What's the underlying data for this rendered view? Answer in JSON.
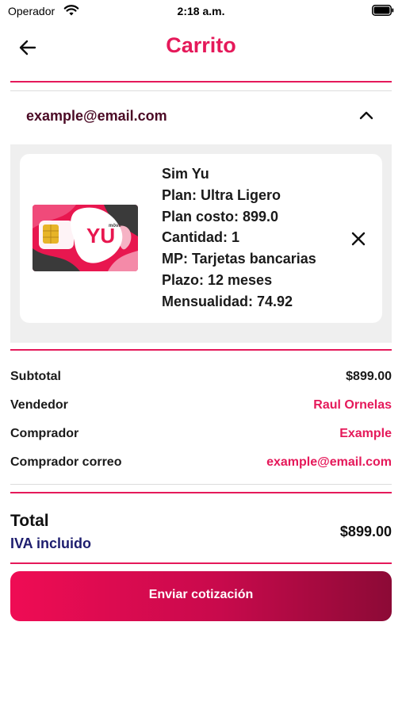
{
  "status_bar": {
    "carrier": "Operador",
    "time": "2:18 a.m."
  },
  "nav": {
    "title": "Carrito"
  },
  "cart": {
    "email": "example@email.com",
    "product": {
      "name": "Sim Yu",
      "plan": "Plan: Ultra Ligero",
      "plan_cost": "Plan costo: 899.0",
      "quantity": "Cantidad: 1",
      "payment_method": "MP: Tarjetas bancarias",
      "term": "Plazo: 12 meses",
      "monthly": "Mensualidad: 74.92",
      "image_brand": "YU",
      "image_subbrand": "mövil"
    }
  },
  "summary": {
    "subtotal_label": "Subtotal",
    "subtotal_value": "$899.00",
    "seller_label": "Vendedor",
    "seller_value": "Raul Ornelas",
    "buyer_label": "Comprador",
    "buyer_value": "Example",
    "buyer_email_label": "Comprador correo",
    "buyer_email_value": "example@email.com"
  },
  "total": {
    "label": "Total",
    "tax_note": "IVA incluido",
    "value": "$899.00"
  },
  "actions": {
    "send_label": "Enviar cotización"
  },
  "colors": {
    "accent": "#e5195a",
    "dark_maroon": "#4b0a25",
    "navy": "#1d1d6e",
    "button_gradient_start": "#ef0c54",
    "button_gradient_end": "#8c0a36"
  }
}
